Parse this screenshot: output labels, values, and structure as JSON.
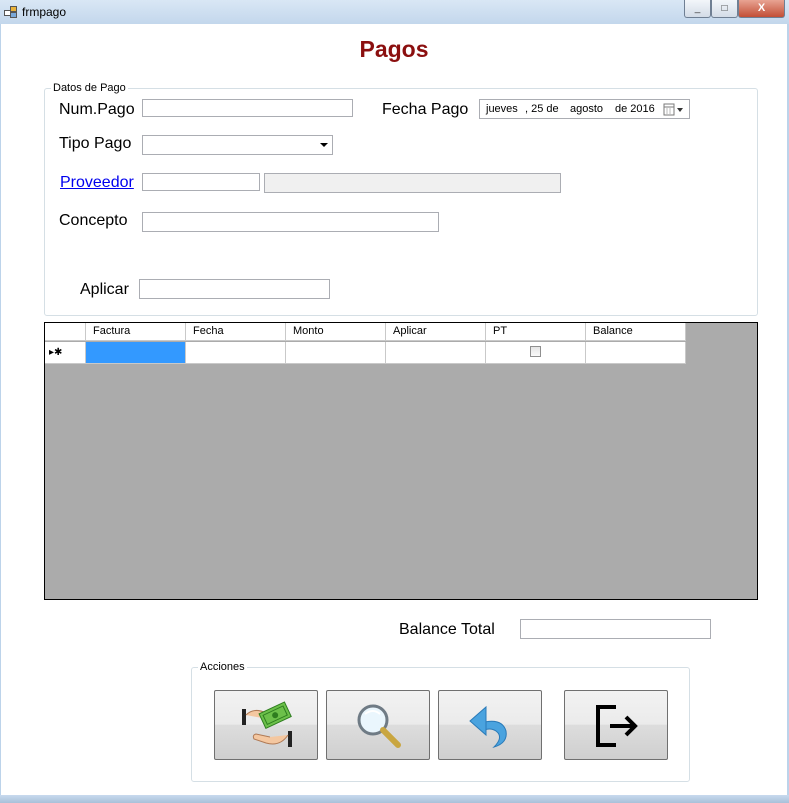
{
  "window": {
    "title": "frmpago",
    "controls": {
      "minimize": "_",
      "maximize": "□",
      "close": "X"
    }
  },
  "form": {
    "heading": "Pagos",
    "datos_group": {
      "legend": "Datos de Pago",
      "num_pago_label": "Num.Pago",
      "num_pago_value": "",
      "fecha_pago_label": "Fecha Pago",
      "fecha_pago": {
        "weekday": "jueves",
        "day": ", 25 de",
        "month": "agosto",
        "year": "de 2016"
      },
      "tipo_pago_label": "Tipo Pago",
      "tipo_pago_value": "",
      "proveedor_link": "Proveedor",
      "proveedor_code": "",
      "proveedor_name": "",
      "concepto_label": "Concepto",
      "concepto_value": "",
      "aplicar_label": "Aplicar",
      "aplicar_value": ""
    },
    "grid": {
      "columns": [
        "Factura",
        "Fecha",
        "Monto",
        "Aplicar",
        "PT",
        "Balance"
      ],
      "new_row_indicator": "▸✱",
      "rows": []
    },
    "balance_total_label": "Balance Total",
    "balance_total_value": "",
    "acciones": {
      "legend": "Acciones",
      "buttons": [
        {
          "name": "pay-button",
          "icon": "money-hands-icon"
        },
        {
          "name": "search-button",
          "icon": "magnifier-icon"
        },
        {
          "name": "undo-button",
          "icon": "undo-arrow-icon"
        },
        {
          "name": "exit-button",
          "icon": "exit-door-icon"
        }
      ]
    }
  },
  "colors": {
    "heading": "#8b0f0f",
    "link": "#0000ee",
    "selected_cell": "#3399ff",
    "grid_background": "#ababab"
  }
}
